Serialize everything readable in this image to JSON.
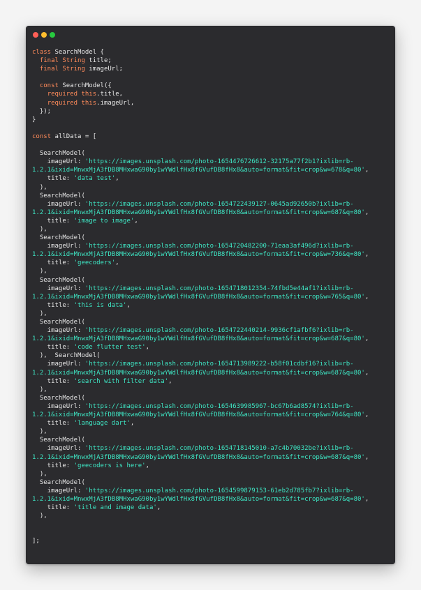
{
  "colors": {
    "background": "#2b2b2e",
    "keyword": "#ff8b5a",
    "string": "#3ee6c4",
    "text": "#e6e6e6"
  },
  "window_controls": [
    "close",
    "minimize",
    "maximize"
  ],
  "code_lines": [
    [
      [
        "k",
        "class"
      ],
      [
        "p",
        " SearchModel {"
      ]
    ],
    [
      [
        "p",
        "  "
      ],
      [
        "k",
        "final"
      ],
      [
        "p",
        " "
      ],
      [
        "k",
        "String"
      ],
      [
        "p",
        " title;"
      ]
    ],
    [
      [
        "p",
        "  "
      ],
      [
        "k",
        "final"
      ],
      [
        "p",
        " "
      ],
      [
        "k",
        "String"
      ],
      [
        "p",
        " imageUrl;"
      ]
    ],
    [],
    [
      [
        "p",
        "  "
      ],
      [
        "k",
        "const"
      ],
      [
        "p",
        " SearchModel({"
      ]
    ],
    [
      [
        "p",
        "    "
      ],
      [
        "k",
        "required"
      ],
      [
        "p",
        " "
      ],
      [
        "k",
        "this"
      ],
      [
        "p",
        ".title,"
      ]
    ],
    [
      [
        "p",
        "    "
      ],
      [
        "k",
        "required"
      ],
      [
        "p",
        " "
      ],
      [
        "k",
        "this"
      ],
      [
        "p",
        ".imageUrl,"
      ]
    ],
    [
      [
        "p",
        "  });"
      ]
    ],
    [
      [
        "p",
        "}"
      ]
    ],
    [],
    [
      [
        "k",
        "const"
      ],
      [
        "p",
        " allData = ["
      ]
    ],
    [],
    [
      [
        "p",
        "  SearchModel("
      ]
    ],
    [
      [
        "p",
        "    imageUrl: "
      ],
      [
        "s",
        "'https://images.unsplash.com/photo-1654476726612-32175a77f2b1?ixlib=rb-"
      ]
    ],
    [
      [
        "s",
        "1.2.1&ixid=MnwxMjA3fDB8MHxwaG90by1wYWdlfHx8fGVufDB8fHx8&auto=format&fit=crop&w=678&q=80'"
      ],
      [
        "p",
        ","
      ]
    ],
    [
      [
        "p",
        "    title: "
      ],
      [
        "s",
        "'data test'"
      ],
      [
        "p",
        ","
      ]
    ],
    [
      [
        "p",
        "  ),"
      ]
    ],
    [
      [
        "p",
        "  SearchModel("
      ]
    ],
    [
      [
        "p",
        "    imageUrl: "
      ],
      [
        "s",
        "'https://images.unsplash.com/photo-1654722439127-0645ad92650b?ixlib=rb-"
      ]
    ],
    [
      [
        "s",
        "1.2.1&ixid=MnwxMjA3fDB8MHxwaG90by1wYWdlfHx8fGVufDB8fHx8&auto=format&fit=crop&w=687&q=80'"
      ],
      [
        "p",
        ","
      ]
    ],
    [
      [
        "p",
        "    title: "
      ],
      [
        "s",
        "'image to image'"
      ],
      [
        "p",
        ","
      ]
    ],
    [
      [
        "p",
        "  ),"
      ]
    ],
    [
      [
        "p",
        "  SearchModel("
      ]
    ],
    [
      [
        "p",
        "    imageUrl: "
      ],
      [
        "s",
        "'https://images.unsplash.com/photo-1654720482200-71eaa3af496d?ixlib=rb-"
      ]
    ],
    [
      [
        "s",
        "1.2.1&ixid=MnwxMjA3fDB8MHxwaG90by1wYWdlfHx8fGVufDB8fHx8&auto=format&fit=crop&w=736&q=80'"
      ],
      [
        "p",
        ","
      ]
    ],
    [
      [
        "p",
        "    title: "
      ],
      [
        "s",
        "'geecoders'"
      ],
      [
        "p",
        ","
      ]
    ],
    [
      [
        "p",
        "  ),"
      ]
    ],
    [
      [
        "p",
        "  SearchModel("
      ]
    ],
    [
      [
        "p",
        "    imageUrl: "
      ],
      [
        "s",
        "'https://images.unsplash.com/photo-1654718012354-74fbd5e44af1?ixlib=rb-"
      ]
    ],
    [
      [
        "s",
        "1.2.1&ixid=MnwxMjA3fDB8MHxwaG90by1wYWdlfHx8fGVufDB8fHx8&auto=format&fit=crop&w=765&q=80'"
      ],
      [
        "p",
        ","
      ]
    ],
    [
      [
        "p",
        "    title: "
      ],
      [
        "s",
        "'this is data'"
      ],
      [
        "p",
        ","
      ]
    ],
    [
      [
        "p",
        "  ),"
      ]
    ],
    [
      [
        "p",
        "  SearchModel("
      ]
    ],
    [
      [
        "p",
        "    imageUrl: "
      ],
      [
        "s",
        "'https://images.unsplash.com/photo-1654722440214-9936cf1afbf6?ixlib=rb-"
      ]
    ],
    [
      [
        "s",
        "1.2.1&ixid=MnwxMjA3fDB8MHxwaG90by1wYWdlfHx8fGVufDB8fHx8&auto=format&fit=crop&w=687&q=80'"
      ],
      [
        "p",
        ","
      ]
    ],
    [
      [
        "p",
        "    title: "
      ],
      [
        "s",
        "'code flutter test'"
      ],
      [
        "p",
        ","
      ]
    ],
    [
      [
        "p",
        "  ),  SearchModel("
      ]
    ],
    [
      [
        "p",
        "    imageUrl: "
      ],
      [
        "s",
        "'https://images.unsplash.com/photo-1654713989222-b58f01cdbf16?ixlib=rb-"
      ]
    ],
    [
      [
        "s",
        "1.2.1&ixid=MnwxMjA3fDB8MHxwaG90by1wYWdlfHx8fGVufDB8fHx8&auto=format&fit=crop&w=687&q=80'"
      ],
      [
        "p",
        ","
      ]
    ],
    [
      [
        "p",
        "    title: "
      ],
      [
        "s",
        "'search with filter data'"
      ],
      [
        "p",
        ","
      ]
    ],
    [
      [
        "p",
        "  ),"
      ]
    ],
    [
      [
        "p",
        "  SearchModel("
      ]
    ],
    [
      [
        "p",
        "    imageUrl: "
      ],
      [
        "s",
        "'https://images.unsplash.com/photo-1654639985967-bc67b6ad8574?ixlib=rb-"
      ]
    ],
    [
      [
        "s",
        "1.2.1&ixid=MnwxMjA3fDB8MHxwaG90by1wYWdlfHx8fGVufDB8fHx8&auto=format&fit=crop&w=764&q=80'"
      ],
      [
        "p",
        ","
      ]
    ],
    [
      [
        "p",
        "    title: "
      ],
      [
        "s",
        "'language dart'"
      ],
      [
        "p",
        ","
      ]
    ],
    [
      [
        "p",
        "  ),"
      ]
    ],
    [
      [
        "p",
        "  SearchModel("
      ]
    ],
    [
      [
        "p",
        "    imageUrl: "
      ],
      [
        "s",
        "'https://images.unsplash.com/photo-1654718145010-a7c4b70032be?ixlib=rb-"
      ]
    ],
    [
      [
        "s",
        "1.2.1&ixid=MnwxMjA3fDB8MHxwaG90by1wYWdlfHx8fGVufDB8fHx8&auto=format&fit=crop&w=687&q=80'"
      ],
      [
        "p",
        ","
      ]
    ],
    [
      [
        "p",
        "    title: "
      ],
      [
        "s",
        "'geecoders is here'"
      ],
      [
        "p",
        ","
      ]
    ],
    [
      [
        "p",
        "  ),"
      ]
    ],
    [
      [
        "p",
        "  SearchModel("
      ]
    ],
    [
      [
        "p",
        "    imageUrl: "
      ],
      [
        "s",
        "'https://images.unsplash.com/photo-1654599879153-61eb2d785fb7?ixlib=rb-"
      ]
    ],
    [
      [
        "s",
        "1.2.1&ixid=MnwxMjA3fDB8MHxwaG90by1wYWdlfHx8fGVufDB8fHx8&auto=format&fit=crop&w=687&q=80'"
      ],
      [
        "p",
        ","
      ]
    ],
    [
      [
        "p",
        "    title: "
      ],
      [
        "s",
        "'title and image data'"
      ],
      [
        "p",
        ","
      ]
    ],
    [
      [
        "p",
        "  ),"
      ]
    ],
    [],
    [],
    [
      [
        "p",
        "];"
      ]
    ]
  ]
}
